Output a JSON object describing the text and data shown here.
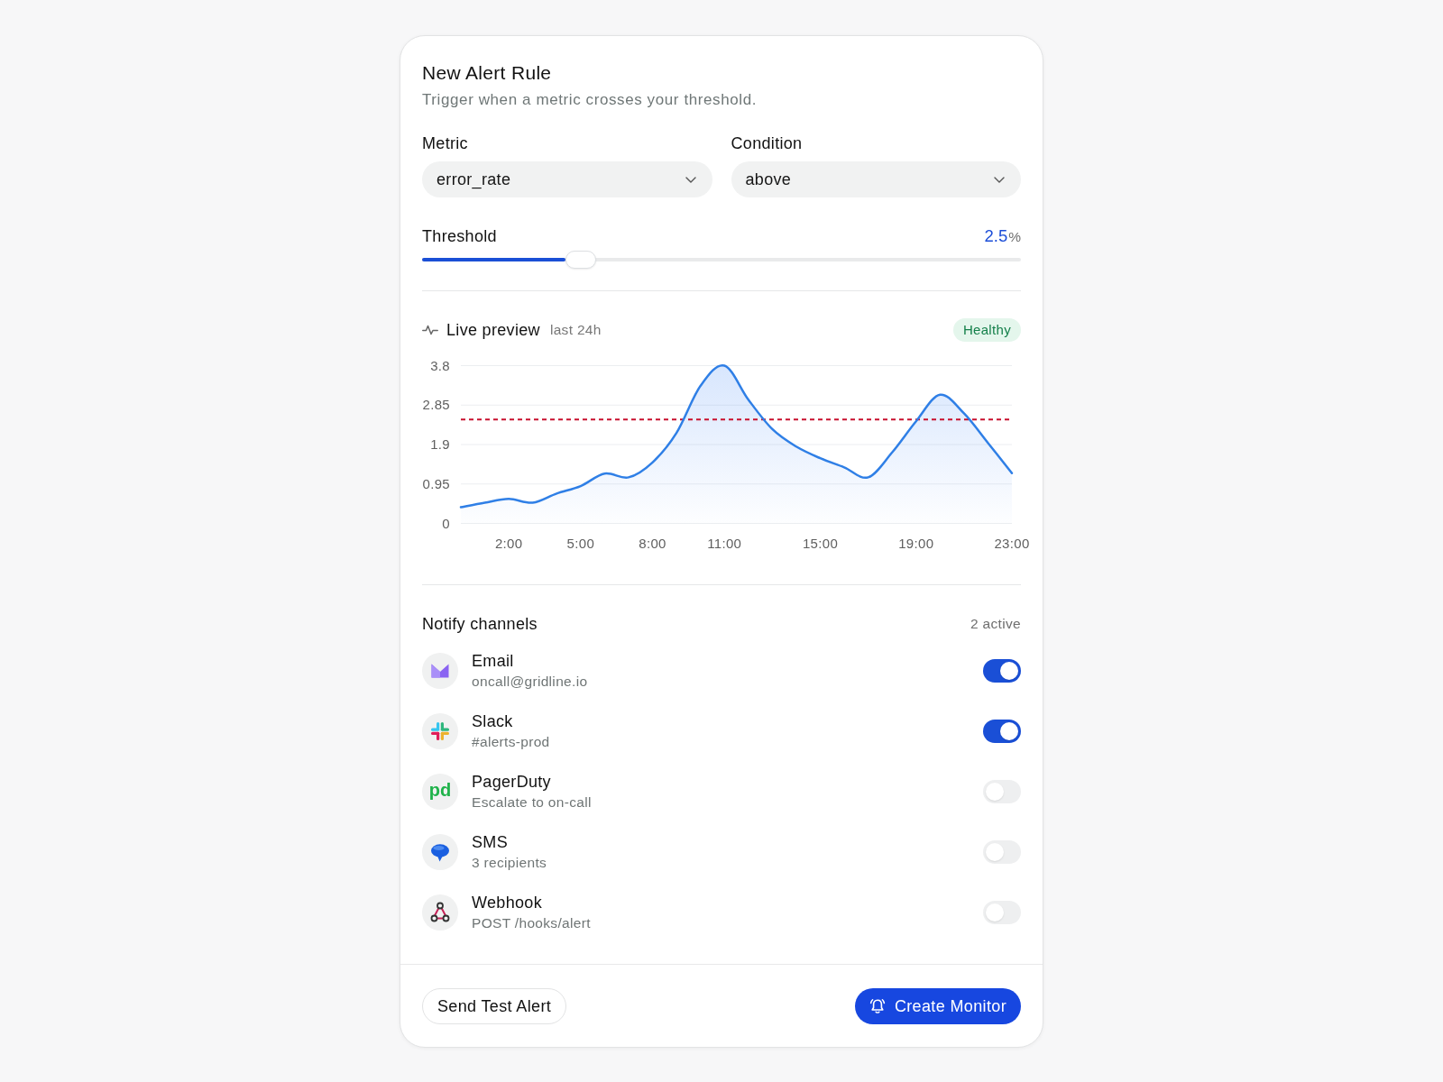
{
  "card": {
    "title": "New Alert Rule",
    "subtitle": "Trigger when a metric crosses your threshold."
  },
  "fields": [
    {
      "label": "Metric",
      "value": "error_rate"
    },
    {
      "label": "Condition",
      "value": "above"
    }
  ],
  "threshold": {
    "label": "Threshold",
    "value": "2.5",
    "unit": "%",
    "level": 0.24
  },
  "live_preview": {
    "title": "Live preview",
    "range": "last 24h",
    "status": "Healthy",
    "chart_data": {
      "type": "area",
      "x": [
        0,
        1,
        2,
        3,
        4,
        5,
        6,
        7,
        8,
        9,
        10,
        11,
        12,
        13,
        14,
        15,
        16,
        17,
        18,
        19,
        20,
        21,
        22,
        23
      ],
      "values": [
        0.39,
        0.5,
        0.59,
        0.5,
        0.72,
        0.9,
        1.2,
        1.11,
        1.47,
        2.18,
        3.31,
        3.8,
        2.98,
        2.27,
        1.85,
        1.57,
        1.35,
        1.11,
        1.71,
        2.46,
        3.1,
        2.65,
        1.94,
        1.21
      ],
      "xlim": [
        0,
        23
      ],
      "ylim": [
        0,
        3.8
      ],
      "xticks": [
        {
          "value": 2,
          "label": "2:00"
        },
        {
          "value": 5,
          "label": "5:00"
        },
        {
          "value": 8,
          "label": "8:00"
        },
        {
          "value": 11,
          "label": "11:00"
        },
        {
          "value": 15,
          "label": "15:00"
        },
        {
          "value": 19,
          "label": "19:00"
        },
        {
          "value": 23,
          "label": "23:00"
        }
      ],
      "yticks": [
        0,
        0.95,
        1.9,
        2.85,
        3.8
      ],
      "grid": true,
      "ref_lines": [
        {
          "axis": "y",
          "value": 2.5
        }
      ]
    }
  },
  "notify": {
    "title": "Notify channels",
    "count": "2 active",
    "channels": [
      {
        "name": "Email",
        "detail": "oncall@gridline.io",
        "on": true
      },
      {
        "name": "Slack",
        "detail": "#alerts-prod",
        "on": true
      },
      {
        "name": "PagerDuty",
        "detail": "Escalate to on-call",
        "on": false,
        "logo_text": "pd"
      },
      {
        "name": "SMS",
        "detail": "3 recipients",
        "on": false
      },
      {
        "name": "Webhook",
        "detail": "POST /hooks/alert",
        "on": false
      }
    ]
  },
  "buttons": [
    {
      "label": "Send Test Alert",
      "kind": "secondary"
    },
    {
      "label": "Create Monitor",
      "kind": "primary"
    }
  ]
}
